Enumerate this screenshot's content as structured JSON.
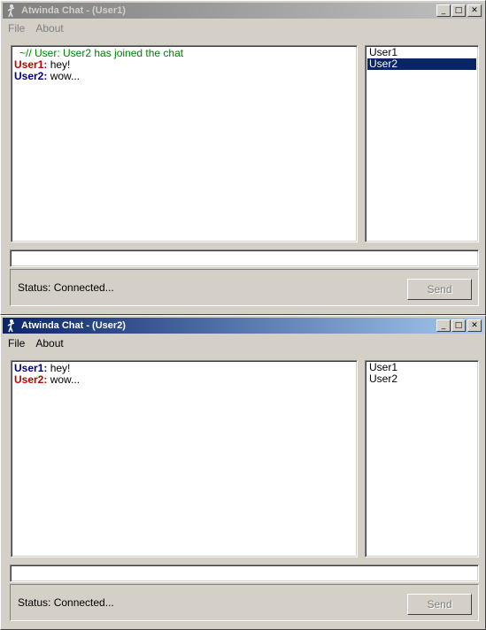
{
  "windows": [
    {
      "title": "Atwinda Chat - (User1)",
      "menu": [
        "File",
        "About"
      ],
      "messages": [
        {
          "kind": "system",
          "text": "~// User: User2 has joined the chat"
        },
        {
          "kind": "user",
          "sender": "User1:",
          "text": " hey!",
          "color": "red"
        },
        {
          "kind": "user",
          "sender": "User2:",
          "text": " wow...",
          "color": "blue"
        }
      ],
      "users": [
        {
          "name": "User1",
          "selected": false
        },
        {
          "name": "User2",
          "selected": true
        }
      ],
      "input_value": "",
      "status": "Status:  Connected...",
      "send_label": "Send"
    },
    {
      "title": "Atwinda Chat - (User2)",
      "menu": [
        "File",
        "About"
      ],
      "messages": [
        {
          "kind": "user",
          "sender": "User1:",
          "text": " hey!",
          "color": "blue"
        },
        {
          "kind": "user",
          "sender": "User2:",
          "text": " wow...",
          "color": "red"
        }
      ],
      "users": [
        {
          "name": "User1",
          "selected": false
        },
        {
          "name": "User2",
          "selected": false
        }
      ],
      "input_value": "",
      "status": "Status:  Connected...",
      "send_label": "Send"
    }
  ],
  "caption_buttons": {
    "minimize": "_",
    "maximize": "□",
    "close": "✕"
  },
  "colors": {
    "red_sender": "#c00000",
    "blue_sender": "#000080",
    "system": "#008000",
    "selection": "#0a246a"
  }
}
